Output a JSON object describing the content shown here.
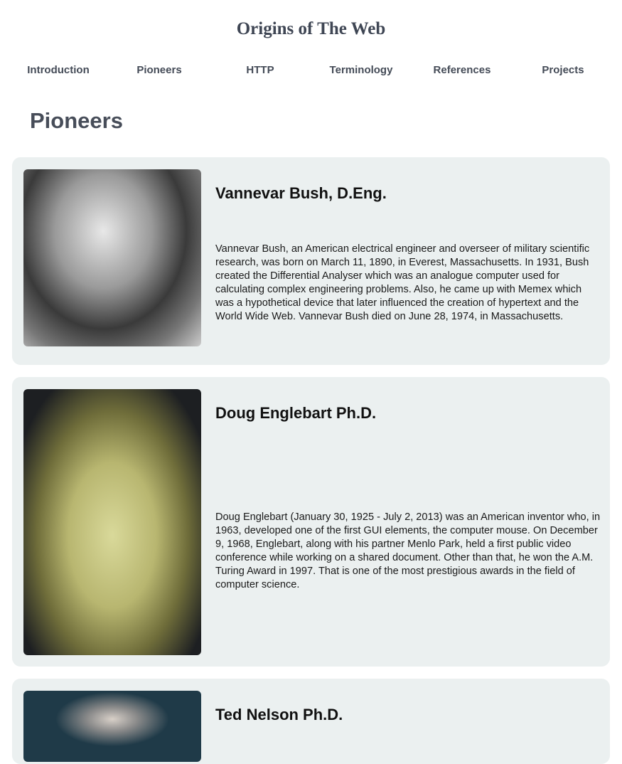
{
  "site_title": "Origins of The Web",
  "nav": [
    "Introduction",
    "Pioneers",
    "HTTP",
    "Terminology",
    "References",
    "Projects"
  ],
  "page_heading": "Pioneers",
  "pioneers": [
    {
      "name": "Vannevar Bush, D.Eng.",
      "bio": "Vannevar Bush, an American electrical engineer and overseer of military scientific research, was born on March 11, 1890, in Everest, Massachusetts. In 1931, Bush created the Differential Analyser which was an analogue computer used for calculating complex engineering problems. Also, he came up with Memex which was a hypothetical device that later influenced the creation of hypertext and the World Wide Web. Vannevar Bush died on June 28, 1974, in Massachusetts."
    },
    {
      "name": "Doug Englebart Ph.D.",
      "bio": "Doug Englebart (January 30, 1925 - July 2, 2013) was an American inventor who, in 1963, developed one of the first GUI elements, the computer mouse. On December 9, 1968, Englebart, along with his partner Menlo Park, held a first public video conference while working on a shared document. Other than that, he won the A.M. Turing Award in 1997. That is one of the most prestigious awards in the field of computer science."
    },
    {
      "name": "Ted Nelson Ph.D."
    }
  ]
}
